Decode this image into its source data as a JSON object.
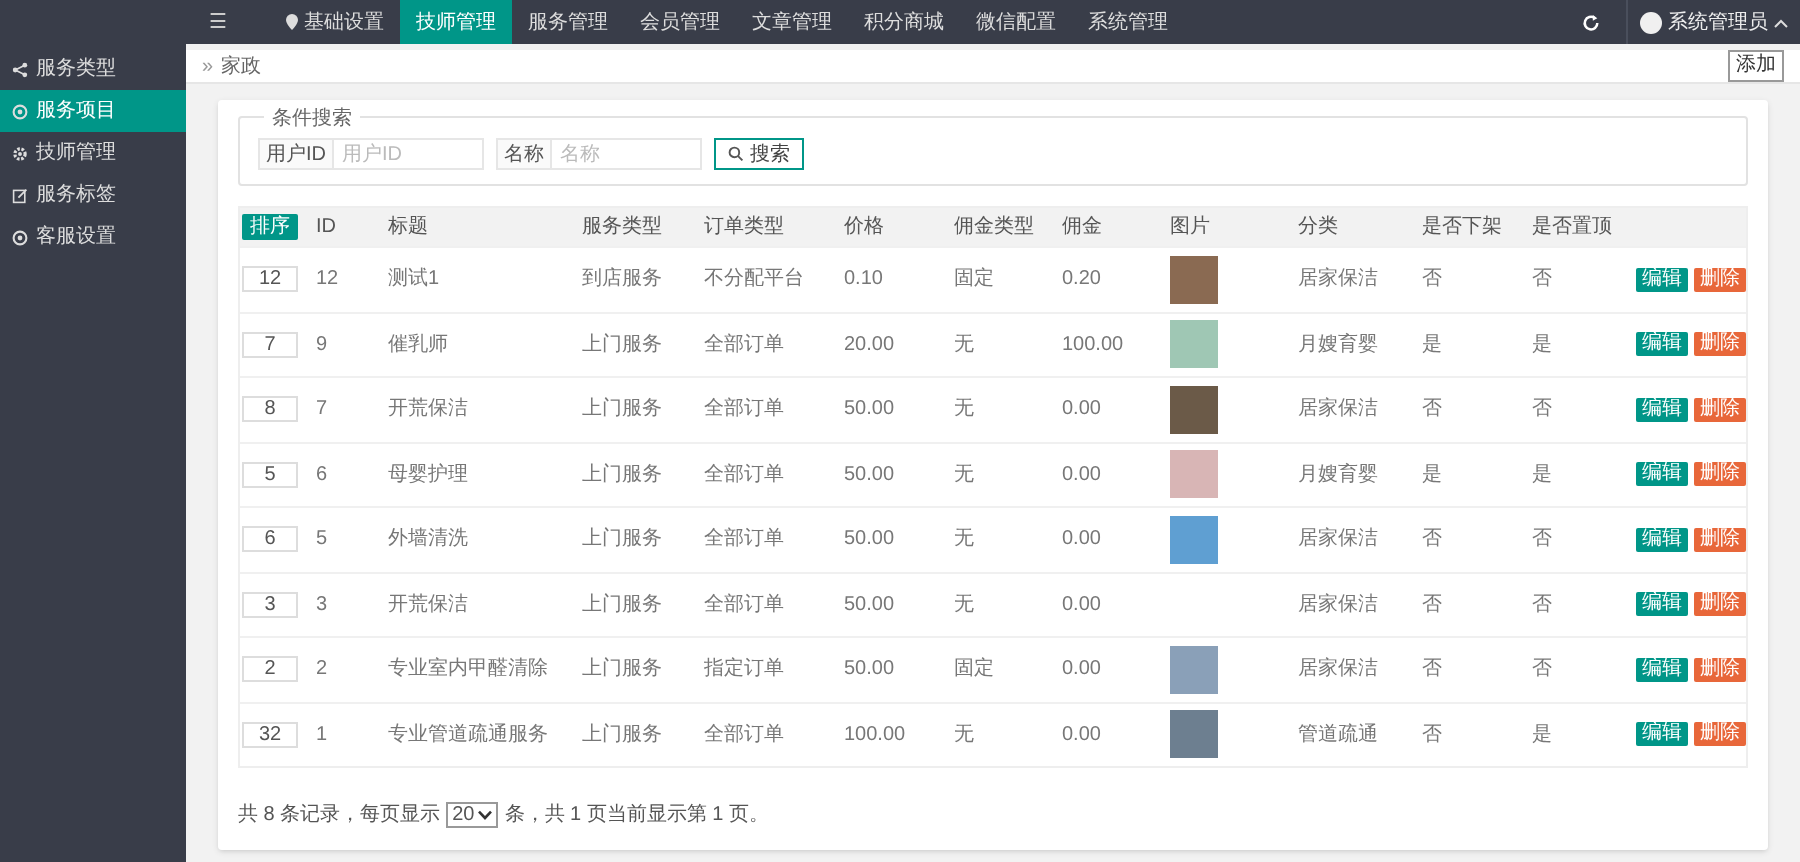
{
  "top_nav": {
    "menu_glyph": "☰",
    "items": [
      {
        "label": "基础设置",
        "selected": false
      },
      {
        "label": "技师管理",
        "selected": true
      },
      {
        "label": "服务管理",
        "selected": false
      },
      {
        "label": "会员管理",
        "selected": false
      },
      {
        "label": "文章管理",
        "selected": false
      },
      {
        "label": "积分商城",
        "selected": false
      },
      {
        "label": "微信配置",
        "selected": false
      },
      {
        "label": "系统管理",
        "selected": false
      }
    ],
    "user": "系统管理员"
  },
  "sidebar": {
    "items": [
      {
        "label": "服务类型",
        "selected": false
      },
      {
        "label": "服务项目",
        "selected": true
      },
      {
        "label": "技师管理",
        "selected": false
      },
      {
        "label": "服务标签",
        "selected": false
      },
      {
        "label": "客服设置",
        "selected": false
      }
    ]
  },
  "breadcrumb": {
    "glyph": "»",
    "label": "家政"
  },
  "add_button": "添加",
  "search": {
    "legend": "条件搜索",
    "fields": [
      {
        "label": "用户ID",
        "placeholder": "用户ID"
      },
      {
        "label": "名称",
        "placeholder": "名称"
      }
    ],
    "button": "搜索"
  },
  "table": {
    "sort_button": "排序",
    "columns": [
      "ID",
      "标题",
      "服务类型",
      "订单类型",
      "价格",
      "佣金类型",
      "佣金",
      "图片",
      "分类",
      "是否下架",
      "是否置顶"
    ],
    "rows": [
      {
        "sort": "12",
        "id": "12",
        "title": "测试1",
        "service_type": "到店服务",
        "order_type": "不分配平台",
        "price": "0.10",
        "commission_type": "固定",
        "commission": "0.20",
        "photo": true,
        "category": "居家保洁",
        "off_shelf": "否",
        "pinned": "否",
        "actions": [
          "编辑",
          "删除"
        ]
      },
      {
        "sort": "7",
        "id": "9",
        "title": "催乳师",
        "service_type": "上门服务",
        "order_type": "全部订单",
        "price": "20.00",
        "commission_type": "无",
        "commission": "100.00",
        "photo": true,
        "category": "月嫂育婴",
        "off_shelf": "是",
        "pinned": "是",
        "actions": [
          "编辑",
          "删除"
        ]
      },
      {
        "sort": "8",
        "id": "7",
        "title": "开荒保洁",
        "service_type": "上门服务",
        "order_type": "全部订单",
        "price": "50.00",
        "commission_type": "无",
        "commission": "0.00",
        "photo": true,
        "category": "居家保洁",
        "off_shelf": "否",
        "pinned": "否",
        "actions": [
          "编辑",
          "删除"
        ]
      },
      {
        "sort": "5",
        "id": "6",
        "title": "母婴护理",
        "service_type": "上门服务",
        "order_type": "全部订单",
        "price": "50.00",
        "commission_type": "无",
        "commission": "0.00",
        "photo": true,
        "category": "月嫂育婴",
        "off_shelf": "是",
        "pinned": "是",
        "actions": [
          "编辑",
          "删除"
        ]
      },
      {
        "sort": "6",
        "id": "5",
        "title": "外墙清洗",
        "service_type": "上门服务",
        "order_type": "全部订单",
        "price": "50.00",
        "commission_type": "无",
        "commission": "0.00",
        "photo": true,
        "category": "居家保洁",
        "off_shelf": "否",
        "pinned": "否",
        "actions": [
          "编辑",
          "删除"
        ]
      },
      {
        "sort": "3",
        "id": "3",
        "title": "开荒保洁",
        "service_type": "上门服务",
        "order_type": "全部订单",
        "price": "50.00",
        "commission_type": "无",
        "commission": "0.00",
        "photo": false,
        "category": "居家保洁",
        "off_shelf": "否",
        "pinned": "否",
        "actions": [
          "编辑",
          "删除"
        ]
      },
      {
        "sort": "2",
        "id": "2",
        "title": "专业室内甲醛清除",
        "service_type": "上门服务",
        "order_type": "指定订单",
        "price": "50.00",
        "commission_type": "固定",
        "commission": "0.00",
        "photo": true,
        "category": "居家保洁",
        "off_shelf": "否",
        "pinned": "否",
        "actions": [
          "编辑",
          "删除"
        ]
      },
      {
        "sort": "32",
        "id": "1",
        "title": "专业管道疏通服务",
        "service_type": "上门服务",
        "order_type": "全部订单",
        "price": "100.00",
        "commission_type": "无",
        "commission": "0.00",
        "photo": true,
        "category": "管道疏通",
        "off_shelf": "否",
        "pinned": "是",
        "actions": [
          "编辑",
          "删除"
        ]
      }
    ]
  },
  "footer": {
    "before": "共 8 条记录，每页显示",
    "page_size": "20",
    "after": "条，共 1 页当前显示第 1 页。"
  }
}
